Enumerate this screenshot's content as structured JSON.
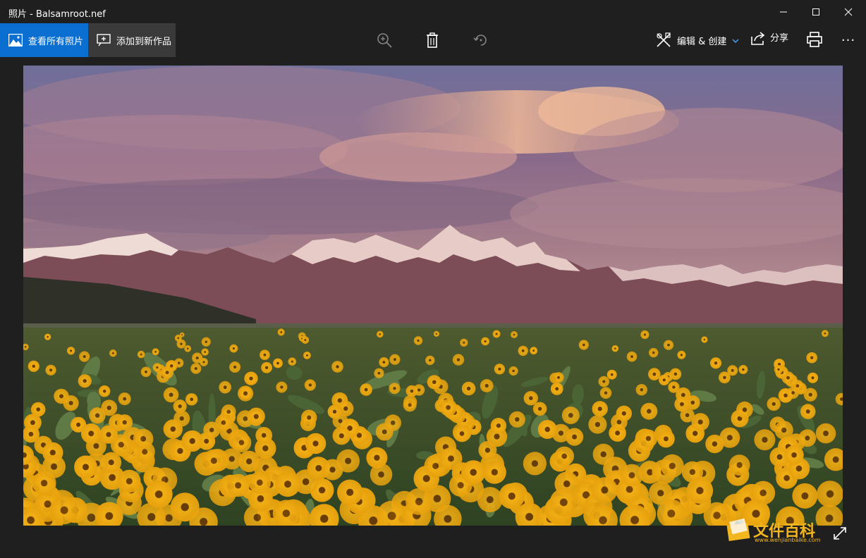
{
  "window": {
    "title": "照片 - Balsamroot.nef"
  },
  "toolbar": {
    "view_all_label": "查看所有照片",
    "add_to_creation_label": "添加到新作品",
    "edit_create_label": "编辑 & 创建",
    "share_label": "分享",
    "more_label": "···"
  },
  "watermark": {
    "text": "文件百科",
    "url": "www.wenjianbaike.com"
  },
  "colors": {
    "accent": "#0a6fd1",
    "background": "#1f1f1f",
    "secondary_button": "#3a3a3a",
    "watermark": "#f2b61f"
  },
  "icons": [
    "minimize-icon",
    "maximize-icon",
    "close-icon",
    "image-icon",
    "add-to-creation-icon",
    "zoom-in-icon",
    "delete-icon",
    "rotate-icon",
    "edit-create-icon",
    "chevron-down-icon",
    "share-icon",
    "print-icon",
    "more-icon",
    "fullscreen-icon"
  ]
}
